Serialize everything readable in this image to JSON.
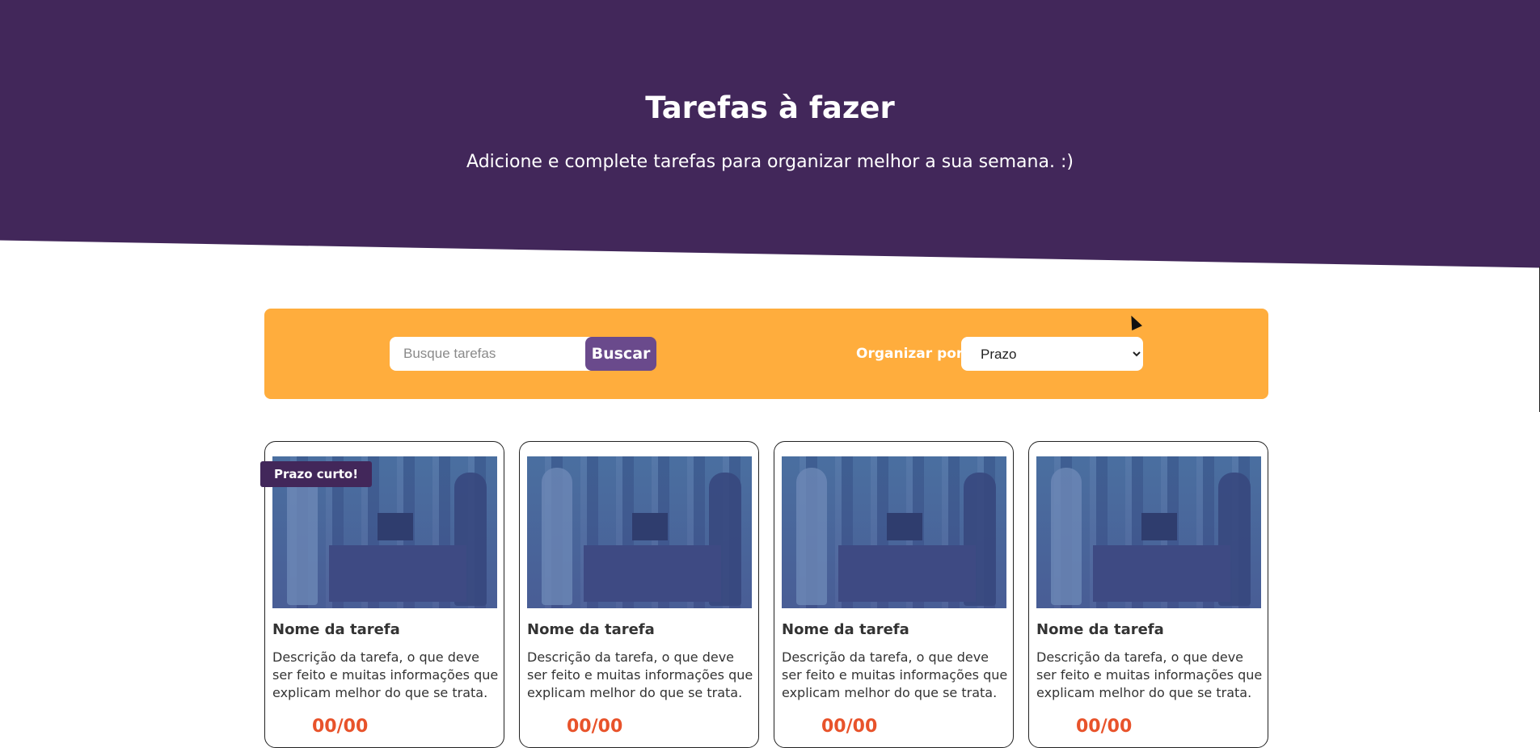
{
  "hero": {
    "title": "Tarefas à fazer",
    "subtitle": "Adicione e complete tarefas para organizar melhor a sua semana. :)"
  },
  "toolbar": {
    "search_placeholder": "Busque tarefas",
    "search_button": "Buscar",
    "sort_label": "Organizar por:",
    "sort_selected": "Prazo"
  },
  "cards": [
    {
      "badge": "Prazo curto!",
      "title": "Nome da tarefa",
      "description": "Descrição da tarefa, o que deve ser feito e muitas informações que explicam melhor do que se trata.",
      "date": "00/00"
    },
    {
      "title": "Nome da tarefa",
      "description": "Descrição da tarefa, o que deve ser feito e muitas informações que explicam melhor do que se trata.",
      "date": "00/00"
    },
    {
      "title": "Nome da tarefa",
      "description": "Descrição da tarefa, o que deve ser feito e muitas informações que explicam melhor do que se trata.",
      "date": "00/00"
    },
    {
      "title": "Nome da tarefa",
      "description": "Descrição da tarefa, o que deve ser feito e muitas informações que explicam melhor do que se trata.",
      "date": "00/00"
    }
  ],
  "colors": {
    "hero_bg": "#42275a",
    "toolbar_bg": "#ffad3d",
    "button_bg": "#6a4a8c",
    "date_color": "#e8532b"
  }
}
